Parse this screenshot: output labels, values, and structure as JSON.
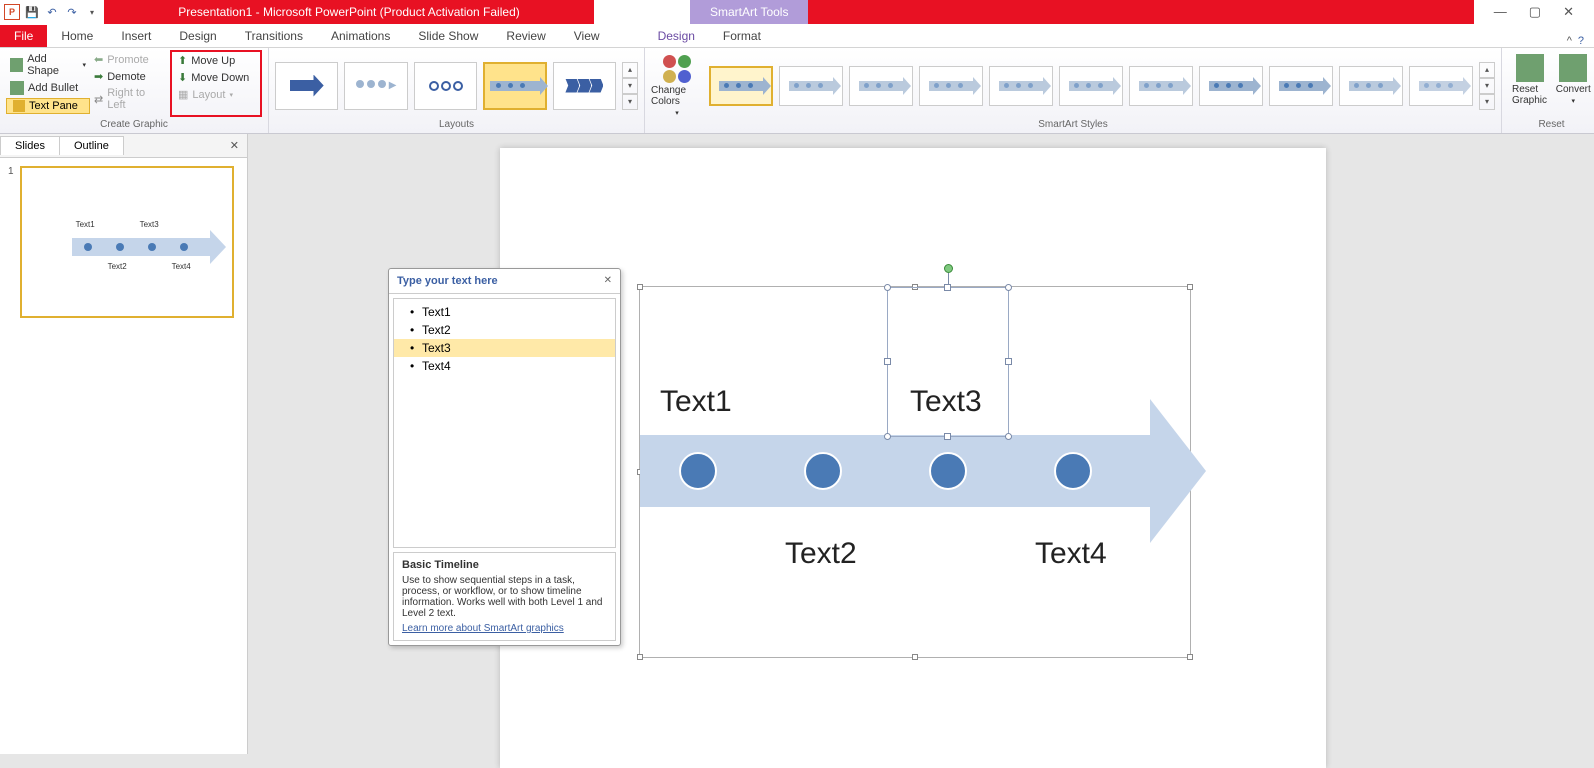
{
  "titlebar": {
    "title": "Presentation1 - Microsoft PowerPoint (Product Activation Failed)",
    "tools_title": "SmartArt Tools"
  },
  "menu": {
    "file": "File",
    "items": [
      "Home",
      "Insert",
      "Design",
      "Transitions",
      "Animations",
      "Slide Show",
      "Review",
      "View"
    ],
    "context_items": [
      "Design",
      "Format"
    ]
  },
  "ribbon": {
    "create_graphic": {
      "add_shape": "Add Shape",
      "add_bullet": "Add Bullet",
      "text_pane": "Text Pane",
      "promote": "Promote",
      "demote": "Demote",
      "right_to_left": "Right to Left",
      "move_up": "Move Up",
      "move_down": "Move Down",
      "layout": "Layout",
      "label": "Create Graphic"
    },
    "layouts": {
      "label": "Layouts"
    },
    "styles": {
      "change_colors": "Change Colors",
      "label": "SmartArt Styles"
    },
    "reset": {
      "reset_graphic": "Reset Graphic",
      "convert": "Convert",
      "label": "Reset"
    }
  },
  "panel": {
    "slides_tab": "Slides",
    "outline_tab": "Outline",
    "slide_number": "1",
    "thumb_texts": [
      "Text1",
      "Text2",
      "Text3",
      "Text4"
    ]
  },
  "textpane": {
    "header": "Type your text here",
    "items": [
      "Text1",
      "Text2",
      "Text3",
      "Text4"
    ],
    "selected_index": 2,
    "footer_title": "Basic Timeline",
    "footer_body": "Use to show sequential steps in a task, process, or workflow, or to show timeline information. Works well with both Level 1 and Level 2 text.",
    "footer_link": "Learn more about SmartArt graphics"
  },
  "smartart": {
    "texts": [
      "Text1",
      "Text2",
      "Text3",
      "Text4"
    ]
  }
}
